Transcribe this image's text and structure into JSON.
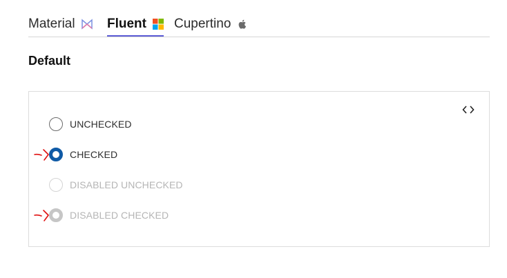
{
  "tabs": [
    {
      "label": "Material",
      "icon": "material-logo-icon",
      "active": false
    },
    {
      "label": "Fluent",
      "icon": "windows-logo-icon",
      "active": true
    },
    {
      "label": "Cupertino",
      "icon": "apple-logo-icon",
      "active": false
    }
  ],
  "section": {
    "title": "Default"
  },
  "demo": {
    "code_toggle_icon": "code-brackets-icon",
    "radios": [
      {
        "label": "UNCHECKED",
        "checked": false,
        "disabled": false
      },
      {
        "label": "CHECKED",
        "checked": true,
        "disabled": false
      },
      {
        "label": "DISABLED UNCHECKED",
        "checked": false,
        "disabled": true
      },
      {
        "label": "DISABLED CHECKED",
        "checked": true,
        "disabled": true
      }
    ]
  },
  "colors": {
    "accent_underline": "#5b5bd6",
    "radio_checked": "#0f5aa6",
    "annotation": "#e01010"
  }
}
